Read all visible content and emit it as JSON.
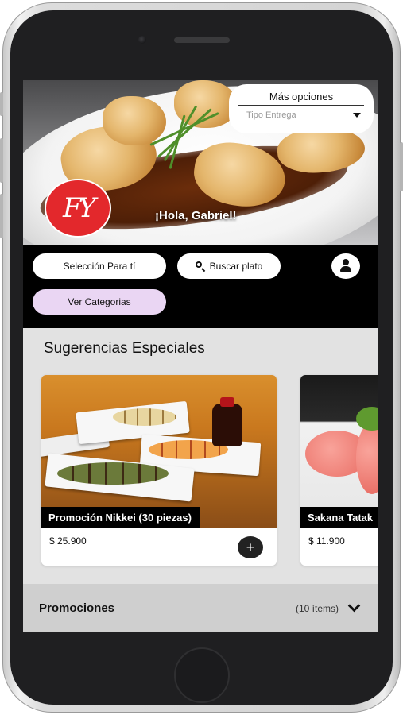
{
  "hero": {
    "options_title": "Más opciones",
    "delivery_placeholder": "Tipo Entrega",
    "logo_text": "FY",
    "greeting": "¡Hola, Gabriel!"
  },
  "actions": {
    "selection_label": "Selección Para tí",
    "search_label": "Buscar plato",
    "categories_label": "Ver Categorias"
  },
  "suggestions": {
    "title": "Sugerencias Especiales",
    "items": [
      {
        "name": "Promoción Nikkei (30 piezas)",
        "price": "$ 25.900",
        "add": "+"
      },
      {
        "name": "Sakana Tatak",
        "price": "$ 11.900"
      }
    ]
  },
  "promotions": {
    "title": "Promociones",
    "count": "(10 ítems)"
  },
  "icons": [
    "search-icon",
    "user-icon",
    "chevron-down-icon",
    "plus-icon",
    "dropdown-arrow-icon"
  ],
  "colors": {
    "band": "#000000",
    "category_pill": "#ead6f3",
    "logo": "#e3282c",
    "screen_bg": "#e2e2e2",
    "promo_bar": "#cfcfcf"
  }
}
